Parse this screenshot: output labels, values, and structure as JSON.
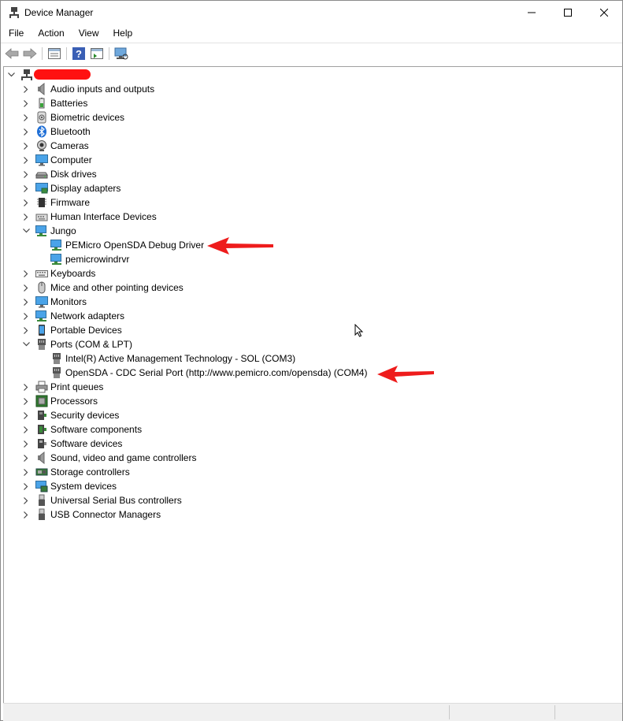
{
  "window": {
    "title": "Device Manager"
  },
  "menu": {
    "file": "File",
    "action": "Action",
    "view": "View",
    "help": "Help"
  },
  "root_label": "",
  "tree": {
    "audio": "Audio inputs and outputs",
    "batteries": "Batteries",
    "biometric": "Biometric devices",
    "bluetooth": "Bluetooth",
    "cameras": "Cameras",
    "computer": "Computer",
    "disk": "Disk drives",
    "display": "Display adapters",
    "firmware": "Firmware",
    "hid": "Human Interface Devices",
    "jungo": "Jungo",
    "jungo_pemicro": "PEMicro OpenSDA Debug Driver",
    "jungo_windrvr": "pemicrowindrvr",
    "keyboards": "Keyboards",
    "mice": "Mice and other pointing devices",
    "monitors": "Monitors",
    "network": "Network adapters",
    "portable": "Portable Devices",
    "ports": "Ports (COM & LPT)",
    "ports_intel": "Intel(R) Active Management Technology - SOL (COM3)",
    "ports_opensda": "OpenSDA - CDC Serial Port (http://www.pemicro.com/opensda) (COM4)",
    "printq": "Print queues",
    "processors": "Processors",
    "security": "Security devices",
    "swcomp": "Software components",
    "swdev": "Software devices",
    "sound": "Sound, video and game controllers",
    "storage": "Storage controllers",
    "system": "System devices",
    "usb": "Universal Serial Bus controllers",
    "usbconn": "USB Connector Managers"
  },
  "colors": {
    "annotation_red": "#ee1c1c",
    "redaction": "#ff1111"
  },
  "icons": {
    "toolbar": [
      "back-arrow-icon",
      "forward-arrow-icon",
      "properties-icon",
      "help-icon",
      "action-pane-icon",
      "scan-hardware-icon"
    ]
  }
}
